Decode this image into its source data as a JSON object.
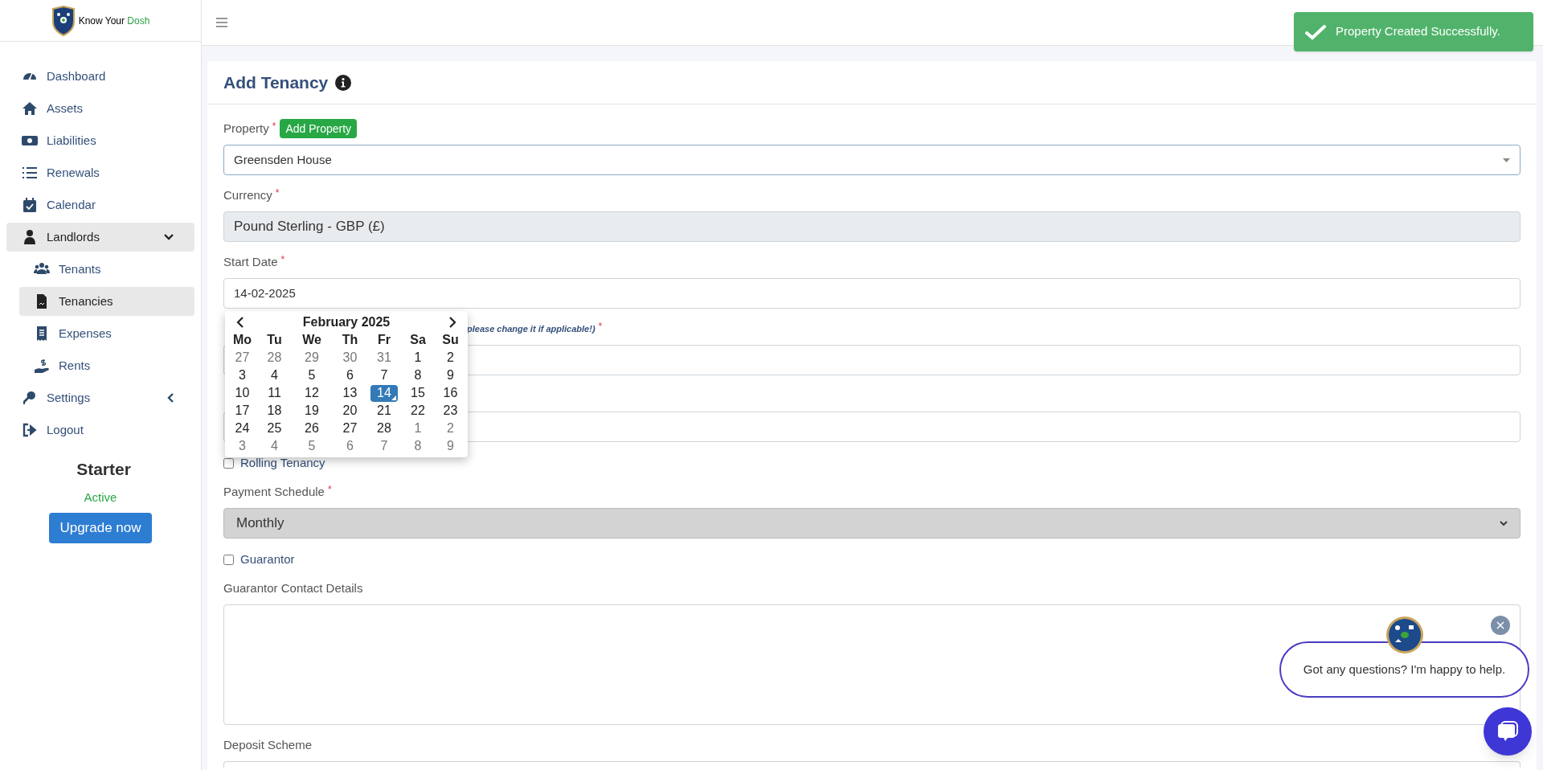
{
  "logo": {
    "text": "Know Your ",
    "accent": "Dosh"
  },
  "sidebar": {
    "items": [
      {
        "label": "Dashboard",
        "selected": false
      },
      {
        "label": "Assets",
        "selected": false
      },
      {
        "label": "Liabilities",
        "selected": false
      },
      {
        "label": "Renewals",
        "selected": false
      },
      {
        "label": "Calendar",
        "selected": false
      },
      {
        "label": "Landlords",
        "selected": true,
        "expanded": true,
        "children": [
          {
            "label": "Tenants",
            "selected": false
          },
          {
            "label": "Tenancies",
            "selected": true
          },
          {
            "label": "Expenses",
            "selected": false
          },
          {
            "label": "Rents",
            "selected": false
          }
        ]
      },
      {
        "label": "Settings",
        "selected": false,
        "expanded": false
      },
      {
        "label": "Logout",
        "selected": false
      }
    ]
  },
  "plan": {
    "name": "Starter",
    "status": "Active",
    "button": "Upgrade now"
  },
  "toast": {
    "message": "Property Created Successfully."
  },
  "form": {
    "title": "Add Tenancy",
    "fields": [
      {
        "kind": "select",
        "label": "Property",
        "required_mark": "*",
        "action": "Add Property",
        "value": "Greensden House"
      },
      {
        "kind": "readonly",
        "label": "Currency",
        "required_mark": "*",
        "value": "Pound Sterling - GBP (£)"
      },
      {
        "kind": "text",
        "label": "Start Date",
        "required_mark": "*",
        "value": "14-02-2025"
      },
      {
        "kind": "text",
        "note": "please change it if applicable!)",
        "required_mark": "*"
      },
      {
        "kind": "text"
      },
      {
        "kind": "checkbox",
        "label": "Rolling Tenancy",
        "checked": false
      },
      {
        "kind": "dropdown",
        "label": "Payment Schedule",
        "required_mark": "*",
        "value": "Monthly"
      },
      {
        "kind": "checkbox",
        "label": "Guarantor",
        "checked": false
      },
      {
        "kind": "textarea",
        "label": "Guarantor Contact Details"
      },
      {
        "kind": "text",
        "label": "Deposit Scheme"
      }
    ]
  },
  "datepicker": {
    "month": "February 2025",
    "weekdays": [
      "Mo",
      "Tu",
      "We",
      "Th",
      "Fr",
      "Sa",
      "Su"
    ],
    "days": [
      {
        "label": "27",
        "muted": true,
        "selected": false
      },
      {
        "label": "28",
        "muted": true,
        "selected": false
      },
      {
        "label": "29",
        "muted": true,
        "selected": false
      },
      {
        "label": "30",
        "muted": true,
        "selected": false
      },
      {
        "label": "31",
        "muted": true,
        "selected": false
      },
      {
        "label": "1",
        "muted": false,
        "selected": false
      },
      {
        "label": "2",
        "muted": false,
        "selected": false
      },
      {
        "label": "3",
        "muted": false,
        "selected": false
      },
      {
        "label": "4",
        "muted": false,
        "selected": false
      },
      {
        "label": "5",
        "muted": false,
        "selected": false
      },
      {
        "label": "6",
        "muted": false,
        "selected": false
      },
      {
        "label": "7",
        "muted": false,
        "selected": false
      },
      {
        "label": "8",
        "muted": false,
        "selected": false
      },
      {
        "label": "9",
        "muted": false,
        "selected": false
      },
      {
        "label": "10",
        "muted": false,
        "selected": false
      },
      {
        "label": "11",
        "muted": false,
        "selected": false
      },
      {
        "label": "12",
        "muted": false,
        "selected": false
      },
      {
        "label": "13",
        "muted": false,
        "selected": false
      },
      {
        "label": "14",
        "muted": false,
        "selected": true
      },
      {
        "label": "15",
        "muted": false,
        "selected": false
      },
      {
        "label": "16",
        "muted": false,
        "selected": false
      },
      {
        "label": "17",
        "muted": false,
        "selected": false
      },
      {
        "label": "18",
        "muted": false,
        "selected": false
      },
      {
        "label": "19",
        "muted": false,
        "selected": false
      },
      {
        "label": "20",
        "muted": false,
        "selected": false
      },
      {
        "label": "21",
        "muted": false,
        "selected": false
      },
      {
        "label": "22",
        "muted": false,
        "selected": false
      },
      {
        "label": "23",
        "muted": false,
        "selected": false
      },
      {
        "label": "24",
        "muted": false,
        "selected": false
      },
      {
        "label": "25",
        "muted": false,
        "selected": false
      },
      {
        "label": "26",
        "muted": false,
        "selected": false
      },
      {
        "label": "27",
        "muted": false,
        "selected": false
      },
      {
        "label": "28",
        "muted": false,
        "selected": false
      },
      {
        "label": "1",
        "muted": true,
        "selected": false
      },
      {
        "label": "2",
        "muted": true,
        "selected": false
      },
      {
        "label": "3",
        "muted": true,
        "selected": false
      },
      {
        "label": "4",
        "muted": true,
        "selected": false
      },
      {
        "label": "5",
        "muted": true,
        "selected": false
      },
      {
        "label": "6",
        "muted": true,
        "selected": false
      },
      {
        "label": "7",
        "muted": true,
        "selected": false
      },
      {
        "label": "8",
        "muted": true,
        "selected": false
      },
      {
        "label": "9",
        "muted": true,
        "selected": false
      }
    ]
  },
  "chat": {
    "message": "Got any questions? I'm happy to help."
  }
}
